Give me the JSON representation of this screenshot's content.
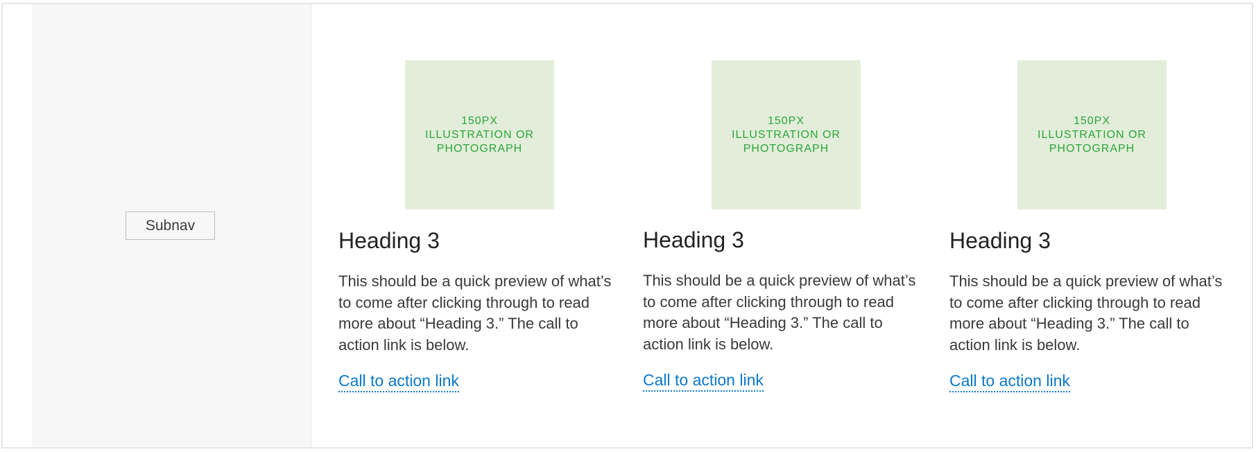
{
  "sidebar": {
    "subnav_label": "Subnav"
  },
  "cards": [
    {
      "image_caption": [
        "150PX",
        "ILLUSTRATION OR",
        "PHOTOGRAPH"
      ],
      "heading": "Heading 3",
      "body": "This should be a quick preview of what’s to come after clicking through to read more about “Heading 3.” The call to action link is below.",
      "cta": "Call to action link"
    },
    {
      "image_caption": [
        "150PX",
        "ILLUSTRATION OR",
        "PHOTOGRAPH"
      ],
      "heading": "Heading 3",
      "body": "This should be a quick preview of what’s to come after clicking through to read more about “Heading 3.” The call to action link is below.",
      "cta": "Call to action link"
    },
    {
      "image_caption": [
        "150PX",
        "ILLUSTRATION OR",
        "PHOTOGRAPH"
      ],
      "heading": "Heading 3",
      "body": "This should be a quick preview of what’s to come after clicking through to read more about “Heading 3.” The call to action link is below.",
      "cta": "Call to action link"
    }
  ],
  "colors": {
    "link": "#0a77c8",
    "image_placeholder_bg": "#e2eed9",
    "image_placeholder_text": "#2ca43d",
    "sidebar_bg": "#f7f7f7"
  }
}
